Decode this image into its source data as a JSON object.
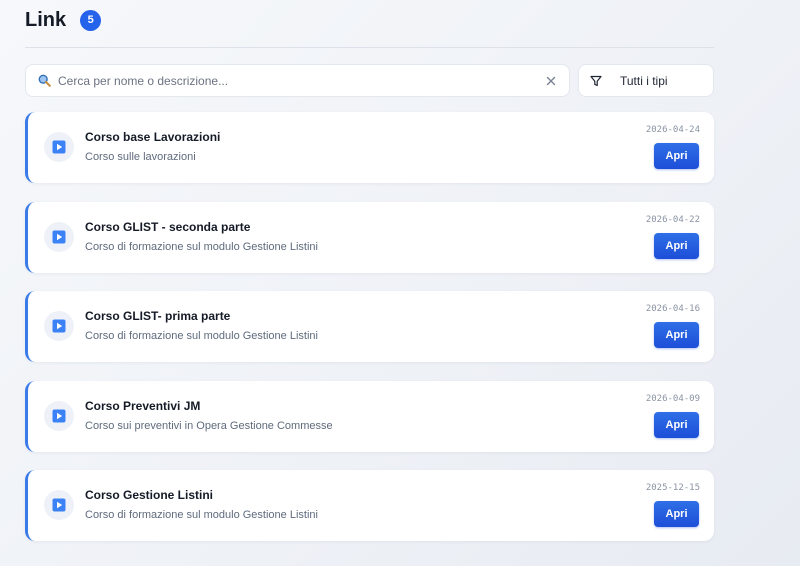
{
  "header": {
    "title": "Link",
    "count": "5"
  },
  "search": {
    "placeholder": "Cerca per nome o descrizione...",
    "value": ""
  },
  "filter": {
    "selected": "Tutti i tipi"
  },
  "colors": {
    "accent": "#2563eb",
    "card_border": "#3b7be8"
  },
  "icons": {
    "search": "search-icon",
    "clear": "close-icon",
    "filter": "filter-icon",
    "item": "video-play-icon"
  },
  "items": [
    {
      "title": "Corso base Lavorazioni",
      "description": "Corso sulle lavorazioni",
      "date": "2026-04-24",
      "button": "Apri"
    },
    {
      "title": "Corso GLIST  - seconda parte",
      "description": "Corso di formazione sul modulo Gestione Listini",
      "date": "2026-04-22",
      "button": "Apri"
    },
    {
      "title": "Corso GLIST- prima parte",
      "description": "Corso di formazione sul modulo Gestione Listini",
      "date": "2026-04-16",
      "button": "Apri"
    },
    {
      "title": "Corso Preventivi JM",
      "description": "Corso sui preventivi in Opera Gestione Commesse",
      "date": "2026-04-09",
      "button": "Apri"
    },
    {
      "title": "Corso Gestione Listini",
      "description": "Corso di formazione sul modulo Gestione Listini",
      "date": "2025-12-15",
      "button": "Apri"
    }
  ]
}
